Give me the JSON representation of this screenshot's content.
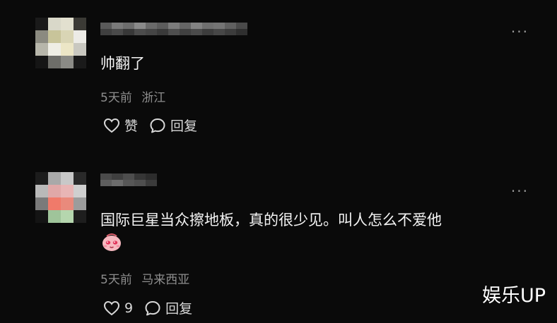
{
  "comments": [
    {
      "text": "帅翻了",
      "time": "5天前",
      "location": "浙江",
      "like_label": "赞",
      "reply_label": "回复",
      "more_glyph": "···"
    },
    {
      "text": "国际巨星当众擦地板，真的很少见。叫人怎么不爱他",
      "time": "5天前",
      "location": "马来西亚",
      "like_label": "9",
      "reply_label": "回复",
      "more_glyph": "···"
    }
  ],
  "watermark": "娱乐UP",
  "icons": {
    "heart": "heart-icon",
    "reply": "speech-bubble-icon",
    "more": "more-icon",
    "emoji": "blushing-face-emoji-icon"
  }
}
